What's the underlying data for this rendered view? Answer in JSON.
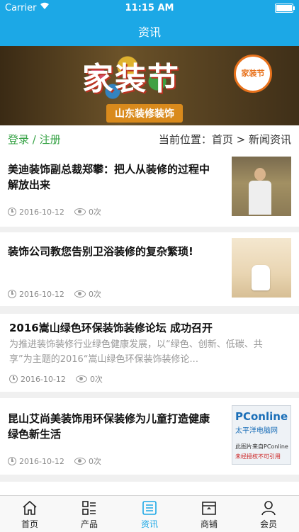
{
  "status_bar": {
    "carrier": "Carrier",
    "time": "11:15 AM"
  },
  "header": {
    "title": "资讯"
  },
  "banner": {
    "headline": "家装节",
    "ribbon": "山东装修装饰",
    "logo_text": "家装节"
  },
  "breadcrumb": {
    "login": "登录",
    "separator": " / ",
    "register": "注册",
    "position": "当前位置：首页 > 新闻资讯"
  },
  "articles": [
    {
      "title_line1": "美迪装饰副总裁郑攀：把人从装修的过程中",
      "title_line2": "解放出来",
      "date": "2016-10-12",
      "views": "0次"
    },
    {
      "title_line1": "装饰公司教您告别卫浴装修的复杂繁琐!",
      "date": "2016-10-12",
      "views": "0次"
    },
    {
      "title_line1": "2016嵩山绿色环保装饰装修论坛 成功召开",
      "summary_line1": "为推进装饰装修行业绿色健康发展，以“绿色、创新、低碳、共",
      "summary_line2": "享”为主题的2016“嵩山绿色环保装饰装修论...",
      "date": "2016-10-12",
      "views": "0次"
    },
    {
      "title_line1": "昆山艾尚美装饰用环保装修为儿童打造健康",
      "title_line2": "绿色新生活",
      "date": "2016-10-12",
      "views": "0次",
      "thumb": {
        "brand": "PConline",
        "sub": "太平洋电脑网",
        "caption": "此图片来自PConline",
        "note": "未经授权不可引用"
      }
    }
  ],
  "tabbar": [
    {
      "label": "首页",
      "icon": "home-icon",
      "active": false
    },
    {
      "label": "产品",
      "icon": "grid-list-icon",
      "active": false
    },
    {
      "label": "资讯",
      "icon": "news-icon",
      "active": true
    },
    {
      "label": "商铺",
      "icon": "shop-icon",
      "active": false
    },
    {
      "label": "会员",
      "icon": "user-icon",
      "active": false
    }
  ],
  "colors": {
    "accent": "#1ca8e6",
    "login": "#37a346"
  }
}
